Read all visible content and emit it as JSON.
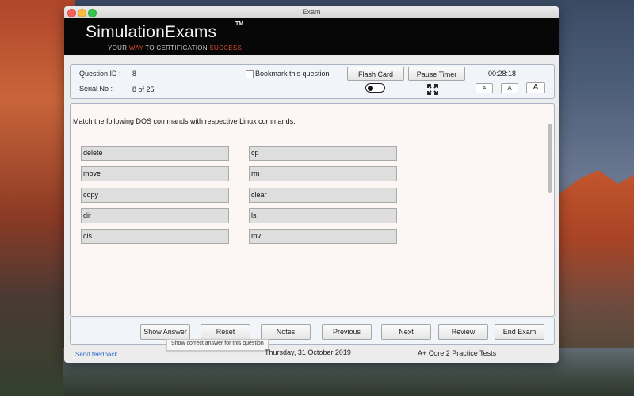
{
  "window": {
    "title": "Exam"
  },
  "banner": {
    "brand": "SimulationExams",
    "trademark": "TM",
    "tagline": {
      "part1": "YOUR ",
      "highlight1": "WAY",
      "part2": " TO CERTIFICATION ",
      "highlight2": "SUCCESS"
    }
  },
  "info": {
    "question_id_label": "Question ID :",
    "question_id": "8",
    "serial_label": "Serial No :",
    "serial": "8 of 25",
    "bookmark_label": "Bookmark this question",
    "flash_card": "Flash Card",
    "pause_timer": "Pause Timer",
    "timer": "00:28:18",
    "font_small": "A",
    "font_medium": "A",
    "font_large": "A"
  },
  "question": {
    "text": "Match the following DOS commands with respective Linux commands.",
    "dos_commands": [
      "delete",
      "move",
      "copy",
      "dir",
      "cls"
    ],
    "linux_commands": [
      "cp",
      "rm",
      "clear",
      "ls",
      "mv"
    ]
  },
  "nav": {
    "show_answer": "Show Answer",
    "reset": "Reset",
    "notes": "Notes",
    "previous": "Previous",
    "next": "Next",
    "review": "Review",
    "end_exam": "End Exam"
  },
  "tooltip": "Show correct answer for this question",
  "footer": {
    "feedback": "Send feedback",
    "date": "Thursday, 31 October 2019",
    "product": "A+ Core 2 Practice Tests"
  },
  "colors": {
    "accent_red": "#d84a30",
    "link_blue": "#2f6fc5",
    "banner_bg": "#070707"
  }
}
